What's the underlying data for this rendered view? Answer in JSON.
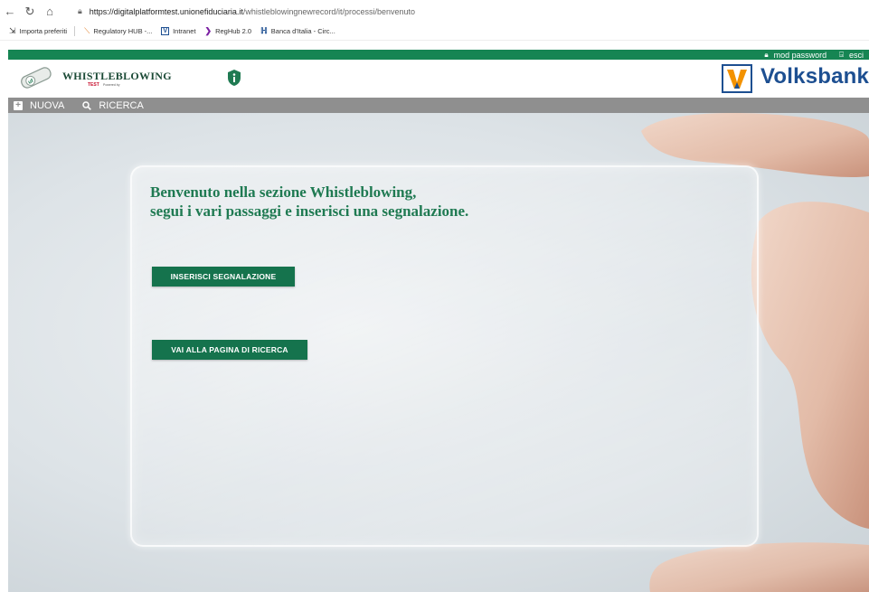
{
  "browser": {
    "url_host": "https://digitalplatformtest.unionefiduciaria.it",
    "url_path": "/whistleblowingnewrecord/it/processi/benvenuto",
    "bookmarks": [
      {
        "label": "Importa preferiti",
        "icon": "import-icon"
      },
      {
        "label": "Regulatory HUB -...",
        "icon": "regulatory-hub-icon"
      },
      {
        "label": "Intranet",
        "icon": "volksbank-v-icon"
      },
      {
        "label": "RegHub 2.0",
        "icon": "reghub-arrow-icon"
      },
      {
        "label": "Banca d'Italia - Circ...",
        "icon": "banca-italia-icon"
      }
    ]
  },
  "header": {
    "mod_password": "mod password",
    "esci": "esci",
    "brand_title": "WHISTLEBLOWING",
    "brand_env": "TEST",
    "brand_powered": "Powered by",
    "bank_name": "Volksbank",
    "bank_letter": "V"
  },
  "menu": {
    "nuova": "NUOVA",
    "ricerca": "RICERCA"
  },
  "main": {
    "welcome_line1": "Benvenuto nella sezione Whistleblowing,",
    "welcome_line2": "segui i vari passaggi e inserisci una segnalazione.",
    "btn_insert": "INSERISCI SEGNALAZIONE",
    "btn_search": "VAI ALLA PAGINA DI RICERCA"
  },
  "colors": {
    "brand_green": "#168553",
    "button_green": "#15734d",
    "menu_gray": "#8f8f8f",
    "volksbank_blue": "#1d4f91",
    "volksbank_orange": "#f39200"
  }
}
